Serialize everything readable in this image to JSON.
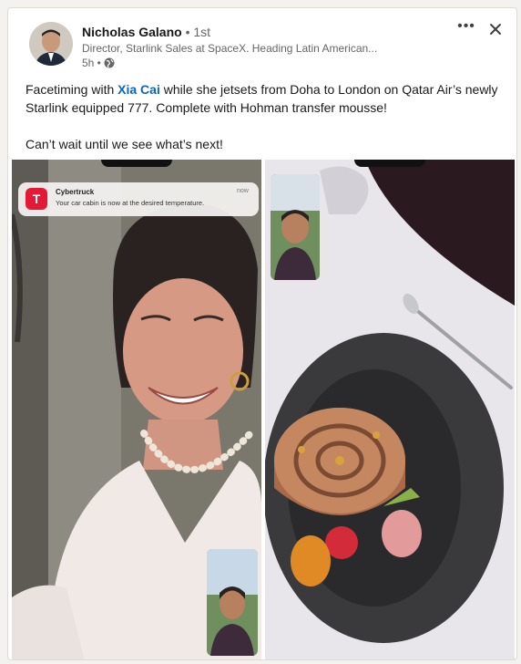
{
  "post": {
    "author_name": "Nicholas Galano",
    "connection_degree": "• 1st",
    "headline": "Director, Starlink Sales at SpaceX. Heading Latin American...",
    "time": "5h •",
    "text_before_mention": "Facetiming with ",
    "mention": "Xia Cai",
    "text_after_mention": " while she jetsets from Doha to London on Qatar Air’s newly Starlink equipped 777. Complete with Hohman transfer mousse!",
    "text_second_paragraph": "Can’t wait until we see what’s next!",
    "more_label": "•••"
  },
  "notification": {
    "app": "Cybertruck",
    "message": "Your car cabin is now at the desired temperature.",
    "time": "now",
    "icon_letter": "T"
  },
  "icons": {
    "more": "more-options-icon",
    "close": "close-icon",
    "globe": "globe-icon",
    "notification": "tesla-logo-icon"
  },
  "colors": {
    "mention": "#0a66c2",
    "tesla_red": "#e31937",
    "card_bg": "#ffffff",
    "page_bg": "#f3f2ef"
  }
}
